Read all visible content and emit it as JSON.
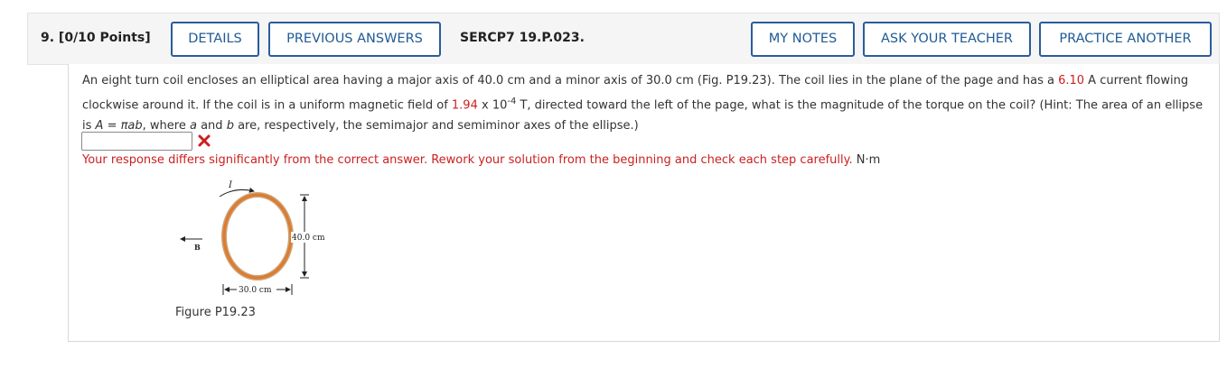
{
  "header": {
    "question_label": "9.  [0/10 Points]",
    "details_label": "DETAILS",
    "previous_answers_label": "PREVIOUS ANSWERS",
    "problem_code": "SERCP7 19.P.023.",
    "my_notes_label": "MY NOTES",
    "ask_teacher_label": "ASK YOUR TEACHER",
    "practice_another_label": "PRACTICE ANOTHER"
  },
  "question": {
    "part1": "An eight turn coil encloses an elliptical area having a major axis of 40.0 cm and a minor axis of 30.0 cm (Fig. P19.23). The coil lies in the plane of the page and has a ",
    "current_value": "6.10",
    "part2": " A current flowing clockwise around it. If the coil is in a uniform magnetic field of ",
    "field_value": "1.94",
    "field_times": " x 10",
    "field_exponent": "-4",
    "part3": " T, directed toward the left of the page, what is the magnitude of the torque on the coil? (Hint: The area of an ellipse is ",
    "formula_A": "A",
    "formula_eq": " = ",
    "formula_pi_ab": "πab",
    "part4": ", where ",
    "var_a": "a",
    "part5": " and ",
    "var_b": "b",
    "part6": " are, respectively, the semimajor and semiminor axes of the ellipse.)"
  },
  "answer": {
    "value": "",
    "status_icon": "x-icon",
    "feedback": "Your response differs significantly from the correct answer. Rework your solution from the beginning and check each step carefully.",
    "unit": "N·m"
  },
  "figure": {
    "current_label": "I",
    "field_label": "B",
    "major_axis_label": "40.0 cm",
    "minor_axis_label": "30.0 cm",
    "caption": "Figure P19.23"
  },
  "colors": {
    "accent": "#2a5c9c",
    "error": "#cc1f1f",
    "coil": "#e07a2a"
  }
}
